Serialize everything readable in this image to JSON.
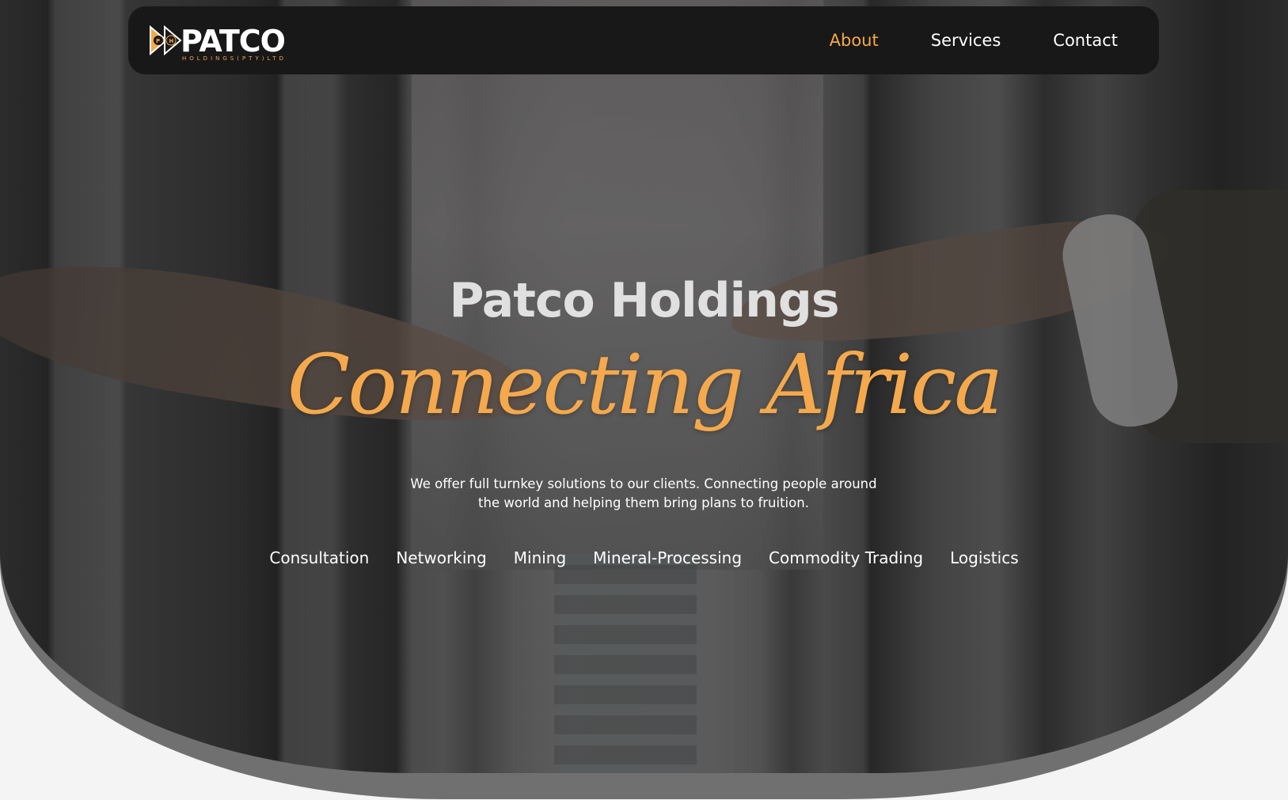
{
  "brand": {
    "name": "PATCO",
    "subtitle": "HOLDINGS(PTY)LTD",
    "mark_letters": "PH",
    "accent_color": "#f5a94c"
  },
  "nav": {
    "items": [
      {
        "label": "About",
        "active": true
      },
      {
        "label": "Services",
        "active": false
      },
      {
        "label": "Contact",
        "active": false
      }
    ]
  },
  "hero": {
    "title": "Patco Holdings",
    "script": "Connecting Africa",
    "description_line1": "We offer full turnkey solutions to our clients. Connecting people around",
    "description_line2": "the world and helping them bring plans to fruition.",
    "services": [
      "Consultation",
      "Networking",
      "Mining",
      "Mineral-Processing",
      "Commodity Trading",
      "Logistics"
    ]
  }
}
